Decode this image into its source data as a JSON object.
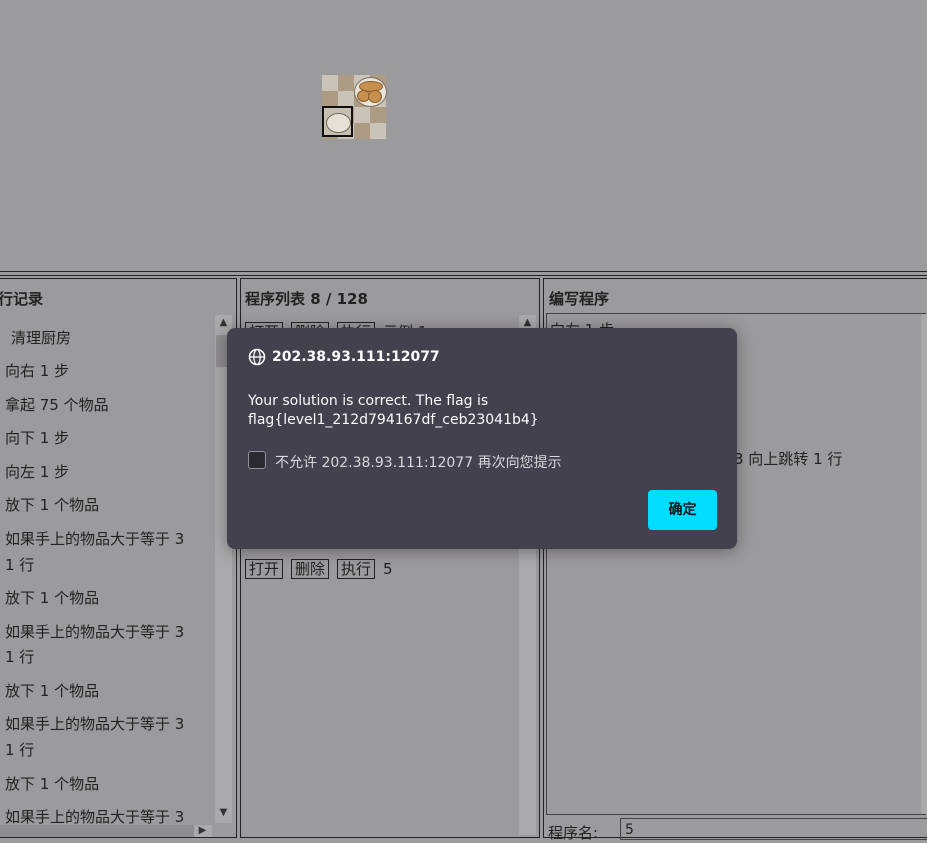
{
  "history": {
    "title": "行记录",
    "items": [
      "清理厨房",
      "向右 1 步",
      "拿起 75 个物品",
      "向下 1 步",
      "向左 1 步",
      "放下 1 个物品",
      "如果手上的物品大于等于 3",
      "1 行",
      "放下 1 个物品",
      "如果手上的物品大于等于 3",
      "1 行",
      "放下 1 个物品",
      "如果手上的物品大于等于 3",
      "1 行",
      "放下 1 个物品",
      "如果手上的物品大于等于 3"
    ]
  },
  "programs": {
    "title": "程序列表 8 / 128",
    "open_label": "打开",
    "delete_label": "删除",
    "run_label": "执行",
    "rows": [
      {
        "name": "示例 1"
      },
      {
        "name": "5"
      }
    ]
  },
  "editor": {
    "title": "编写程序",
    "lines": [
      {
        "text": "向右 1 步"
      },
      {
        "text": "3 向上跳转 1 行"
      }
    ],
    "name_label": "程序名:",
    "name_value": "5"
  },
  "dialog": {
    "origin": "202.38.93.111:12077",
    "message_line1": "Your solution is correct. The flag is",
    "message_line2": "flag{level1_212d794167df_ceb23041b4}",
    "checkbox_label": "不允许 202.38.93.111:12077 再次向您提示",
    "ok_label": "确定"
  },
  "icons": [
    "globe-icon",
    "chevron-up-icon",
    "chevron-down-icon",
    "chevron-right-icon"
  ],
  "colors": {
    "dialog_bg": "#42414d",
    "ok_button": "#00ddff",
    "overlay": "#9b9a9c"
  }
}
